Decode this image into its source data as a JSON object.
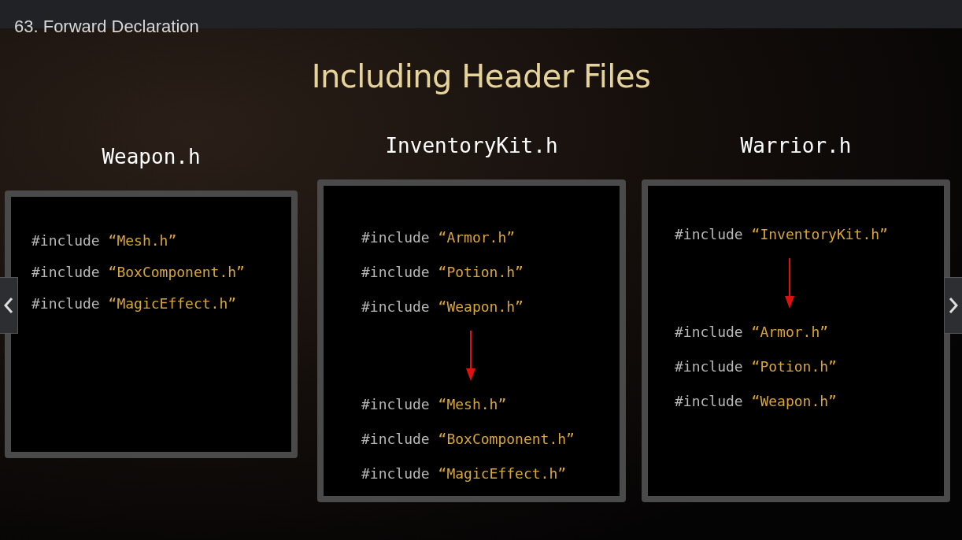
{
  "lecture_title": "63. Forward Declaration",
  "slide": {
    "title": "Including Header Files",
    "panels": [
      {
        "heading": "Weapon.h",
        "lines": [
          {
            "kind": "include",
            "directive": "#include",
            "file": "“Mesh.h”"
          },
          {
            "kind": "include",
            "directive": "#include",
            "file": "“BoxComponent.h”"
          },
          {
            "kind": "include",
            "directive": "#include",
            "file": "“MagicEffect.h”"
          }
        ]
      },
      {
        "heading": "InventoryKit.h",
        "lines": [
          {
            "kind": "include",
            "directive": "#include",
            "file": "“Armor.h”"
          },
          {
            "kind": "include",
            "directive": "#include",
            "file": "“Potion.h”"
          },
          {
            "kind": "include",
            "directive": "#include",
            "file": "“Weapon.h”"
          },
          {
            "kind": "arrow"
          },
          {
            "kind": "include",
            "directive": "#include",
            "file": "“Mesh.h”"
          },
          {
            "kind": "include",
            "directive": "#include",
            "file": "“BoxComponent.h”"
          },
          {
            "kind": "include",
            "directive": "#include",
            "file": "“MagicEffect.h”"
          }
        ]
      },
      {
        "heading": "Warrior.h",
        "lines": [
          {
            "kind": "include",
            "directive": "#include",
            "file": "“InventoryKit.h”"
          },
          {
            "kind": "arrow"
          },
          {
            "kind": "include",
            "directive": "#include",
            "file": "“Armor.h”"
          },
          {
            "kind": "include",
            "directive": "#include",
            "file": "“Potion.h”"
          },
          {
            "kind": "include",
            "directive": "#include",
            "file": "“Weapon.h”"
          }
        ]
      }
    ]
  }
}
